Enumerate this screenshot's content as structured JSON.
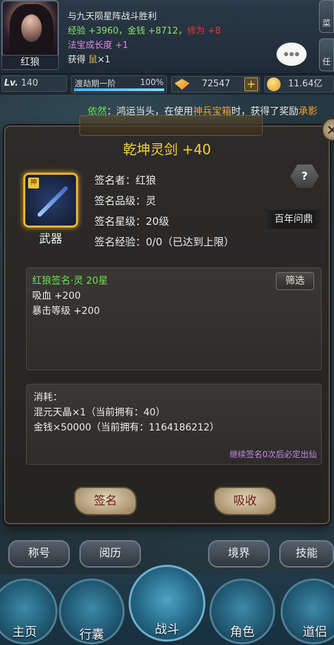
{
  "player": {
    "name": "红狼",
    "level_prefix": "Lv.",
    "level": "140",
    "tribulation_label": "渡劫期一阶",
    "tribulation_pct": "100%",
    "tribulation_progress": 1.0
  },
  "battle_log": {
    "title": "与九天陨星阵战斗胜利",
    "exp": "经验 +3960，金钱 +8712，",
    "cultivation": "修为 +8",
    "fabao": "法宝成长度 +1",
    "got_prefix": "获得 ",
    "got_item": "鼠",
    "got_suffix": "×1"
  },
  "currency": {
    "yuanbao": "72547",
    "gold": "11.64亿",
    "plus": "+"
  },
  "marquee": {
    "who": "依然",
    "sep": "：",
    "text1": "鸿运当头，在使用",
    "highlight": "神兵宝箱",
    "text2": "时，获得了奖励",
    "highlight2": "承影"
  },
  "side_buttons": [
    "菜",
    "任"
  ],
  "dialog": {
    "title": "乾坤灵剑 +40",
    "item_type": "武器",
    "item_badge": "神",
    "close": "×",
    "help": "?",
    "rows": [
      "签名者：红狼",
      "签名品级：灵",
      "签名星级：20级",
      "签名经验：0/0（已达到上限）"
    ],
    "tag": "百年问鼎",
    "attr_title": "红狼签名·灵 20星",
    "attrs": [
      "吸血 +200",
      "暴击等级 +200"
    ],
    "filter": "筛选",
    "cost_title": "消耗：",
    "costs": [
      "混元天晶×1（当前拥有：40）",
      "金钱×50000（当前拥有：1164186212）"
    ],
    "guarantee": "继续签名0次后必定出仙",
    "sign_btn": "签名",
    "absorb_btn": "吸收"
  },
  "sub_nav": [
    "称号",
    "阅历",
    "境界",
    "技能"
  ],
  "main_nav": [
    "主页",
    "行囊",
    "战斗",
    "角色",
    "道侣"
  ]
}
